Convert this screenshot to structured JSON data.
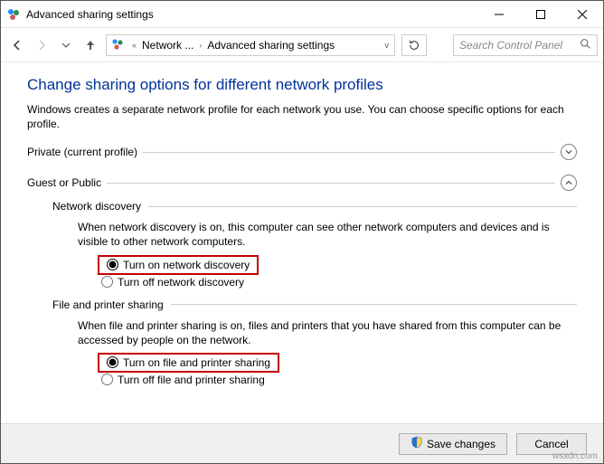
{
  "window": {
    "title": "Advanced sharing settings"
  },
  "breadcrumb": {
    "part1": "Network ...",
    "part2": "Advanced sharing settings"
  },
  "search": {
    "placeholder": "Search Control Panel"
  },
  "page": {
    "heading": "Change sharing options for different network profiles",
    "subtext": "Windows creates a separate network profile for each network you use. You can choose specific options for each profile."
  },
  "sections": {
    "private": {
      "label": "Private (current profile)"
    },
    "guest": {
      "label": "Guest or Public",
      "network_discovery": {
        "label": "Network discovery",
        "desc": "When network discovery is on, this computer can see other network computers and devices and is visible to other network computers.",
        "opt_on": "Turn on network discovery",
        "opt_off": "Turn off network discovery"
      },
      "file_printer": {
        "label": "File and printer sharing",
        "desc": "When file and printer sharing is on, files and printers that you have shared from this computer can be accessed by people on the network.",
        "opt_on": "Turn on file and printer sharing",
        "opt_off": "Turn off file and printer sharing"
      }
    }
  },
  "buttons": {
    "save": "Save changes",
    "cancel": "Cancel"
  },
  "watermark": "wsxdn.com"
}
